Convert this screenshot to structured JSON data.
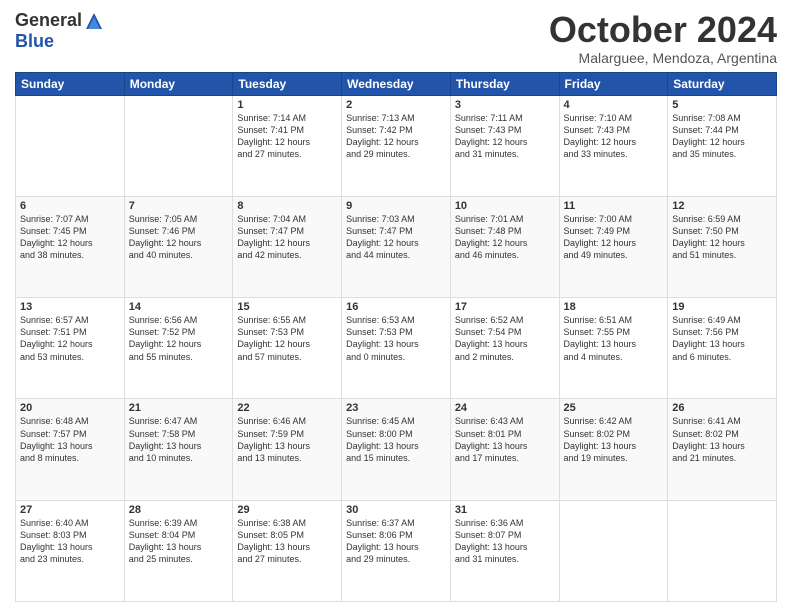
{
  "header": {
    "logo_general": "General",
    "logo_blue": "Blue",
    "month_title": "October 2024",
    "location": "Malarguee, Mendoza, Argentina"
  },
  "weekdays": [
    "Sunday",
    "Monday",
    "Tuesday",
    "Wednesday",
    "Thursday",
    "Friday",
    "Saturday"
  ],
  "weeks": [
    [
      {
        "day": "",
        "info": ""
      },
      {
        "day": "",
        "info": ""
      },
      {
        "day": "1",
        "info": "Sunrise: 7:14 AM\nSunset: 7:41 PM\nDaylight: 12 hours\nand 27 minutes."
      },
      {
        "day": "2",
        "info": "Sunrise: 7:13 AM\nSunset: 7:42 PM\nDaylight: 12 hours\nand 29 minutes."
      },
      {
        "day": "3",
        "info": "Sunrise: 7:11 AM\nSunset: 7:43 PM\nDaylight: 12 hours\nand 31 minutes."
      },
      {
        "day": "4",
        "info": "Sunrise: 7:10 AM\nSunset: 7:43 PM\nDaylight: 12 hours\nand 33 minutes."
      },
      {
        "day": "5",
        "info": "Sunrise: 7:08 AM\nSunset: 7:44 PM\nDaylight: 12 hours\nand 35 minutes."
      }
    ],
    [
      {
        "day": "6",
        "info": "Sunrise: 7:07 AM\nSunset: 7:45 PM\nDaylight: 12 hours\nand 38 minutes."
      },
      {
        "day": "7",
        "info": "Sunrise: 7:05 AM\nSunset: 7:46 PM\nDaylight: 12 hours\nand 40 minutes."
      },
      {
        "day": "8",
        "info": "Sunrise: 7:04 AM\nSunset: 7:47 PM\nDaylight: 12 hours\nand 42 minutes."
      },
      {
        "day": "9",
        "info": "Sunrise: 7:03 AM\nSunset: 7:47 PM\nDaylight: 12 hours\nand 44 minutes."
      },
      {
        "day": "10",
        "info": "Sunrise: 7:01 AM\nSunset: 7:48 PM\nDaylight: 12 hours\nand 46 minutes."
      },
      {
        "day": "11",
        "info": "Sunrise: 7:00 AM\nSunset: 7:49 PM\nDaylight: 12 hours\nand 49 minutes."
      },
      {
        "day": "12",
        "info": "Sunrise: 6:59 AM\nSunset: 7:50 PM\nDaylight: 12 hours\nand 51 minutes."
      }
    ],
    [
      {
        "day": "13",
        "info": "Sunrise: 6:57 AM\nSunset: 7:51 PM\nDaylight: 12 hours\nand 53 minutes."
      },
      {
        "day": "14",
        "info": "Sunrise: 6:56 AM\nSunset: 7:52 PM\nDaylight: 12 hours\nand 55 minutes."
      },
      {
        "day": "15",
        "info": "Sunrise: 6:55 AM\nSunset: 7:53 PM\nDaylight: 12 hours\nand 57 minutes."
      },
      {
        "day": "16",
        "info": "Sunrise: 6:53 AM\nSunset: 7:53 PM\nDaylight: 13 hours\nand 0 minutes."
      },
      {
        "day": "17",
        "info": "Sunrise: 6:52 AM\nSunset: 7:54 PM\nDaylight: 13 hours\nand 2 minutes."
      },
      {
        "day": "18",
        "info": "Sunrise: 6:51 AM\nSunset: 7:55 PM\nDaylight: 13 hours\nand 4 minutes."
      },
      {
        "day": "19",
        "info": "Sunrise: 6:49 AM\nSunset: 7:56 PM\nDaylight: 13 hours\nand 6 minutes."
      }
    ],
    [
      {
        "day": "20",
        "info": "Sunrise: 6:48 AM\nSunset: 7:57 PM\nDaylight: 13 hours\nand 8 minutes."
      },
      {
        "day": "21",
        "info": "Sunrise: 6:47 AM\nSunset: 7:58 PM\nDaylight: 13 hours\nand 10 minutes."
      },
      {
        "day": "22",
        "info": "Sunrise: 6:46 AM\nSunset: 7:59 PM\nDaylight: 13 hours\nand 13 minutes."
      },
      {
        "day": "23",
        "info": "Sunrise: 6:45 AM\nSunset: 8:00 PM\nDaylight: 13 hours\nand 15 minutes."
      },
      {
        "day": "24",
        "info": "Sunrise: 6:43 AM\nSunset: 8:01 PM\nDaylight: 13 hours\nand 17 minutes."
      },
      {
        "day": "25",
        "info": "Sunrise: 6:42 AM\nSunset: 8:02 PM\nDaylight: 13 hours\nand 19 minutes."
      },
      {
        "day": "26",
        "info": "Sunrise: 6:41 AM\nSunset: 8:02 PM\nDaylight: 13 hours\nand 21 minutes."
      }
    ],
    [
      {
        "day": "27",
        "info": "Sunrise: 6:40 AM\nSunset: 8:03 PM\nDaylight: 13 hours\nand 23 minutes."
      },
      {
        "day": "28",
        "info": "Sunrise: 6:39 AM\nSunset: 8:04 PM\nDaylight: 13 hours\nand 25 minutes."
      },
      {
        "day": "29",
        "info": "Sunrise: 6:38 AM\nSunset: 8:05 PM\nDaylight: 13 hours\nand 27 minutes."
      },
      {
        "day": "30",
        "info": "Sunrise: 6:37 AM\nSunset: 8:06 PM\nDaylight: 13 hours\nand 29 minutes."
      },
      {
        "day": "31",
        "info": "Sunrise: 6:36 AM\nSunset: 8:07 PM\nDaylight: 13 hours\nand 31 minutes."
      },
      {
        "day": "",
        "info": ""
      },
      {
        "day": "",
        "info": ""
      }
    ]
  ]
}
